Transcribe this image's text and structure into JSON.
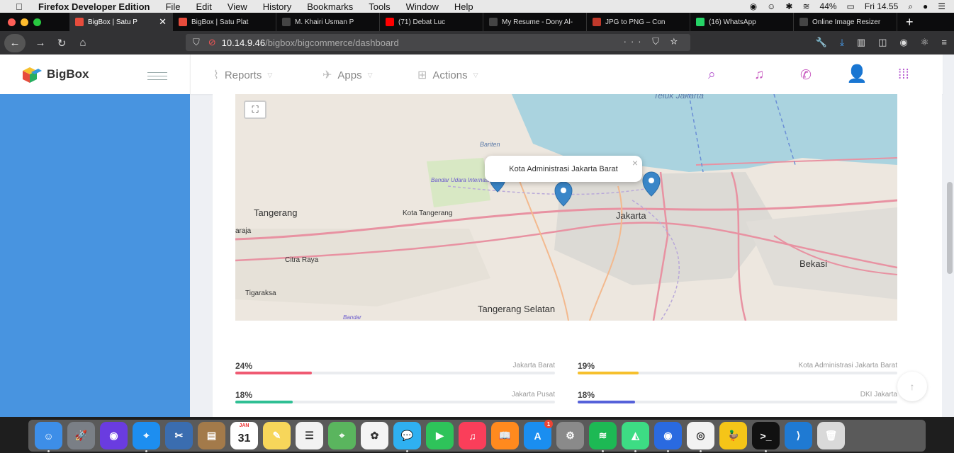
{
  "menubar": {
    "app": "Firefox Developer Edition",
    "items": [
      "File",
      "Edit",
      "View",
      "History",
      "Bookmarks",
      "Tools",
      "Window",
      "Help"
    ],
    "battery": "44%",
    "clock": "Fri 14.55"
  },
  "tabs": [
    {
      "title": "BigBox | Satu P",
      "color": "#e74c3c",
      "active": true
    },
    {
      "title": "BigBox | Satu Plat",
      "color": "#e74c3c"
    },
    {
      "title": "M. Khairi Usman P",
      "color": "#444"
    },
    {
      "title": "(71) Debat Luc",
      "color": "#ff0000"
    },
    {
      "title": "My Resume - Dony Al-",
      "color": "#444"
    },
    {
      "title": "JPG to PNG – Con",
      "color": "#c0392b"
    },
    {
      "title": "(16) WhatsApp",
      "color": "#25d366"
    },
    {
      "title": "Online Image Resizer",
      "color": "#444"
    }
  ],
  "url": {
    "host": "10.14.9.46",
    "path": "/bigbox/bigcommerce/dashboard"
  },
  "brand": {
    "name": "BigBox"
  },
  "topnav": {
    "reports": "Reports",
    "apps": "Apps",
    "actions": "Actions"
  },
  "map": {
    "popup": "Kota Administrasi Jakarta Barat",
    "popup_close": "×",
    "labels": {
      "teluk": "Teluk Jakarta",
      "bariten": "Bariten",
      "bandar": "Bandar Udara Internasional Soekarno-Hatta",
      "tangerang": "Tangerang",
      "kota_tangerang": "Kota Tangerang",
      "jakarta": "Jakarta",
      "citra_raya": "Citra Raya",
      "bekasi": "Bekasi",
      "tigaraksa": "Tigaraksa",
      "tangerang_selatan": "Tangerang Selatan",
      "bandar2": "Bandar",
      "raja": "araja"
    }
  },
  "bars": [
    {
      "pct": "24%",
      "label": "Jakarta Barat",
      "fraction": 0.24,
      "color": "#ef5a72"
    },
    {
      "pct": "19%",
      "label": "Kota Administrasi Jakarta Barat",
      "fraction": 0.19,
      "color": "#f6c02d"
    },
    {
      "pct": "18%",
      "label": "Jakarta Pusat",
      "fraction": 0.18,
      "color": "#2fbf94"
    },
    {
      "pct": "18%",
      "label": "DKI Jakarta",
      "fraction": 0.18,
      "color": "#5561d9"
    }
  ],
  "dock": [
    "Finder",
    "Launchpad",
    "Siri",
    "Safari",
    "Preview",
    "Contacts",
    "Calendar",
    "Notes",
    "Reminders",
    "Maps",
    "Photos",
    "Messages",
    "FaceTime",
    "Music",
    "Books",
    "App Store",
    "System Preferences",
    "Spotify",
    "Android Studio",
    "Firefox Developer Edition",
    "Chrome",
    "Cyberduck",
    "Terminal",
    "VS Code",
    "Trash"
  ],
  "dock_extra": {
    "calendar_month": "JAN",
    "calendar_day": "31",
    "appstore_badge": "1"
  }
}
